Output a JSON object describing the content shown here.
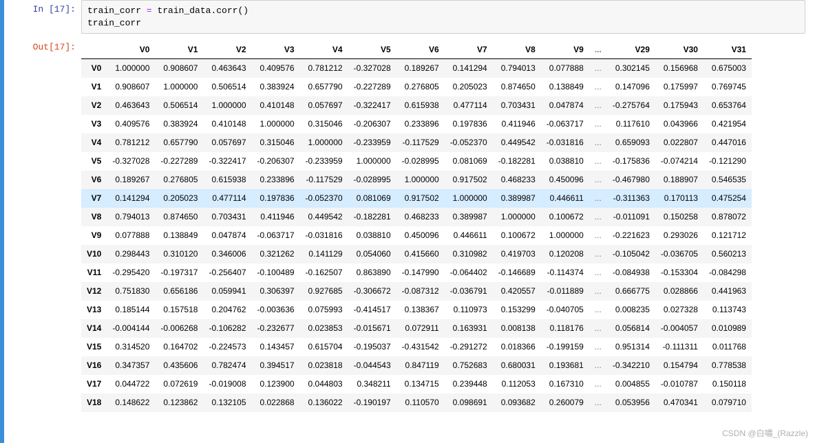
{
  "in_prompt": "In  [17]:",
  "out_prompt": "Out[17]:",
  "code_line1_a": "train_corr ",
  "code_line1_op": "=",
  "code_line1_b": " train_data.corr()",
  "code_line2": "train_corr",
  "columns": [
    "V0",
    "V1",
    "V2",
    "V3",
    "V4",
    "V5",
    "V6",
    "V7",
    "V8",
    "V9",
    "...",
    "V29",
    "V30",
    "V31"
  ],
  "index": [
    "V0",
    "V1",
    "V2",
    "V3",
    "V4",
    "V5",
    "V6",
    "V7",
    "V8",
    "V9",
    "V10",
    "V11",
    "V12",
    "V13",
    "V14",
    "V15",
    "V16",
    "V17",
    "V18"
  ],
  "highlight_row": "V7",
  "chart_data": {
    "type": "table",
    "title": "Correlation matrix (train_data.corr())",
    "columns": [
      "V0",
      "V1",
      "V2",
      "V3",
      "V4",
      "V5",
      "V6",
      "V7",
      "V8",
      "V9",
      "V29",
      "V30",
      "V31"
    ],
    "rows": {
      "V0": [
        "1.000000",
        "0.908607",
        "0.463643",
        "0.409576",
        "0.781212",
        "-0.327028",
        "0.189267",
        "0.141294",
        "0.794013",
        "0.077888",
        "0.302145",
        "0.156968",
        "0.675003"
      ],
      "V1": [
        "0.908607",
        "1.000000",
        "0.506514",
        "0.383924",
        "0.657790",
        "-0.227289",
        "0.276805",
        "0.205023",
        "0.874650",
        "0.138849",
        "0.147096",
        "0.175997",
        "0.769745"
      ],
      "V2": [
        "0.463643",
        "0.506514",
        "1.000000",
        "0.410148",
        "0.057697",
        "-0.322417",
        "0.615938",
        "0.477114",
        "0.703431",
        "0.047874",
        "-0.275764",
        "0.175943",
        "0.653764"
      ],
      "V3": [
        "0.409576",
        "0.383924",
        "0.410148",
        "1.000000",
        "0.315046",
        "-0.206307",
        "0.233896",
        "0.197836",
        "0.411946",
        "-0.063717",
        "0.117610",
        "0.043966",
        "0.421954"
      ],
      "V4": [
        "0.781212",
        "0.657790",
        "0.057697",
        "0.315046",
        "1.000000",
        "-0.233959",
        "-0.117529",
        "-0.052370",
        "0.449542",
        "-0.031816",
        "0.659093",
        "0.022807",
        "0.447016"
      ],
      "V5": [
        "-0.327028",
        "-0.227289",
        "-0.322417",
        "-0.206307",
        "-0.233959",
        "1.000000",
        "-0.028995",
        "0.081069",
        "-0.182281",
        "0.038810",
        "-0.175836",
        "-0.074214",
        "-0.121290"
      ],
      "V6": [
        "0.189267",
        "0.276805",
        "0.615938",
        "0.233896",
        "-0.117529",
        "-0.028995",
        "1.000000",
        "0.917502",
        "0.468233",
        "0.450096",
        "-0.467980",
        "0.188907",
        "0.546535"
      ],
      "V7": [
        "0.141294",
        "0.205023",
        "0.477114",
        "0.197836",
        "-0.052370",
        "0.081069",
        "0.917502",
        "1.000000",
        "0.389987",
        "0.446611",
        "-0.311363",
        "0.170113",
        "0.475254"
      ],
      "V8": [
        "0.794013",
        "0.874650",
        "0.703431",
        "0.411946",
        "0.449542",
        "-0.182281",
        "0.468233",
        "0.389987",
        "1.000000",
        "0.100672",
        "-0.011091",
        "0.150258",
        "0.878072"
      ],
      "V9": [
        "0.077888",
        "0.138849",
        "0.047874",
        "-0.063717",
        "-0.031816",
        "0.038810",
        "0.450096",
        "0.446611",
        "0.100672",
        "1.000000",
        "-0.221623",
        "0.293026",
        "0.121712"
      ],
      "V10": [
        "0.298443",
        "0.310120",
        "0.346006",
        "0.321262",
        "0.141129",
        "0.054060",
        "0.415660",
        "0.310982",
        "0.419703",
        "0.120208",
        "-0.105042",
        "-0.036705",
        "0.560213"
      ],
      "V11": [
        "-0.295420",
        "-0.197317",
        "-0.256407",
        "-0.100489",
        "-0.162507",
        "0.863890",
        "-0.147990",
        "-0.064402",
        "-0.146689",
        "-0.114374",
        "-0.084938",
        "-0.153304",
        "-0.084298"
      ],
      "V12": [
        "0.751830",
        "0.656186",
        "0.059941",
        "0.306397",
        "0.927685",
        "-0.306672",
        "-0.087312",
        "-0.036791",
        "0.420557",
        "-0.011889",
        "0.666775",
        "0.028866",
        "0.441963"
      ],
      "V13": [
        "0.185144",
        "0.157518",
        "0.204762",
        "-0.003636",
        "0.075993",
        "-0.414517",
        "0.138367",
        "0.110973",
        "0.153299",
        "-0.040705",
        "0.008235",
        "0.027328",
        "0.113743"
      ],
      "V14": [
        "-0.004144",
        "-0.006268",
        "-0.106282",
        "-0.232677",
        "0.023853",
        "-0.015671",
        "0.072911",
        "0.163931",
        "0.008138",
        "0.118176",
        "0.056814",
        "-0.004057",
        "0.010989"
      ],
      "V15": [
        "0.314520",
        "0.164702",
        "-0.224573",
        "0.143457",
        "0.615704",
        "-0.195037",
        "-0.431542",
        "-0.291272",
        "0.018366",
        "-0.199159",
        "0.951314",
        "-0.111311",
        "0.011768"
      ],
      "V16": [
        "0.347357",
        "0.435606",
        "0.782474",
        "0.394517",
        "0.023818",
        "-0.044543",
        "0.847119",
        "0.752683",
        "0.680031",
        "0.193681",
        "-0.342210",
        "0.154794",
        "0.778538"
      ],
      "V17": [
        "0.044722",
        "0.072619",
        "-0.019008",
        "0.123900",
        "0.044803",
        "0.348211",
        "0.134715",
        "0.239448",
        "0.112053",
        "0.167310",
        "0.004855",
        "-0.010787",
        "0.150118"
      ],
      "V18": [
        "0.148622",
        "0.123862",
        "0.132105",
        "0.022868",
        "0.136022",
        "-0.190197",
        "0.110570",
        "0.098691",
        "0.093682",
        "0.260079",
        "0.053956",
        "0.470341",
        "0.079710"
      ]
    }
  },
  "ellipsis": "...",
  "watermark": "CSDN @白嘯_(Razzle)"
}
